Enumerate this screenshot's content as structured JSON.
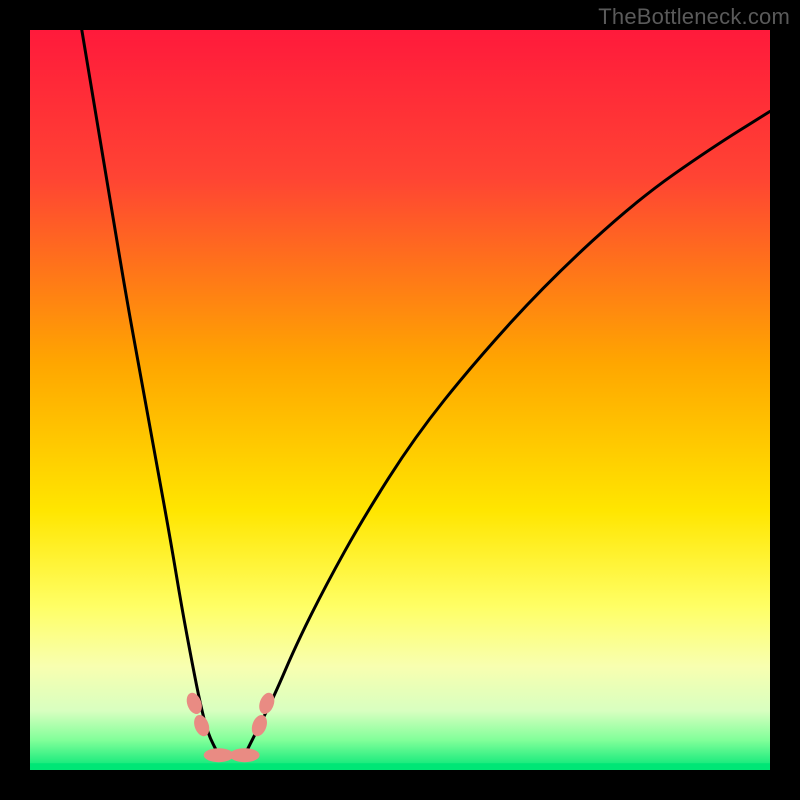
{
  "watermark": "TheBottleneck.com",
  "chart_data": {
    "type": "line",
    "title": "",
    "xlabel": "",
    "ylabel": "",
    "xlim": [
      0,
      100
    ],
    "ylim": [
      0,
      100
    ],
    "background_gradient": {
      "stops": [
        {
          "offset": 0,
          "color": "#ff1a3b"
        },
        {
          "offset": 20,
          "color": "#ff4433"
        },
        {
          "offset": 45,
          "color": "#ffa600"
        },
        {
          "offset": 65,
          "color": "#ffe600"
        },
        {
          "offset": 78,
          "color": "#ffff66"
        },
        {
          "offset": 86,
          "color": "#f8ffb0"
        },
        {
          "offset": 92,
          "color": "#d8ffc0"
        },
        {
          "offset": 96,
          "color": "#80ff99"
        },
        {
          "offset": 100,
          "color": "#00e676"
        }
      ]
    },
    "series": [
      {
        "name": "left-branch",
        "x": [
          7,
          9,
          11,
          13,
          15,
          17,
          19,
          20.5,
          22,
          23,
          24,
          25.5
        ],
        "y": [
          100,
          88,
          76,
          64,
          53,
          42,
          31,
          22,
          14,
          9,
          5,
          2
        ]
      },
      {
        "name": "right-branch",
        "x": [
          29,
          30.5,
          33,
          36,
          40,
          45,
          52,
          60,
          70,
          82,
          92,
          100
        ],
        "y": [
          2,
          5,
          10,
          17,
          25,
          34,
          45,
          55,
          66,
          77,
          84,
          89
        ]
      }
    ],
    "markers": [
      {
        "name": "valley-floor-1",
        "x": 25.5,
        "y": 2
      },
      {
        "name": "valley-floor-2",
        "x": 29,
        "y": 2
      },
      {
        "name": "left-outer",
        "x": 22.2,
        "y": 9
      },
      {
        "name": "left-inner",
        "x": 23.2,
        "y": 6
      },
      {
        "name": "right-inner",
        "x": 31.0,
        "y": 6
      },
      {
        "name": "right-outer",
        "x": 32.0,
        "y": 9
      }
    ],
    "marker_color": "#e98b83",
    "curve_color": "#000000",
    "green_line_color": "#00e676",
    "green_line_y": 0.5
  }
}
